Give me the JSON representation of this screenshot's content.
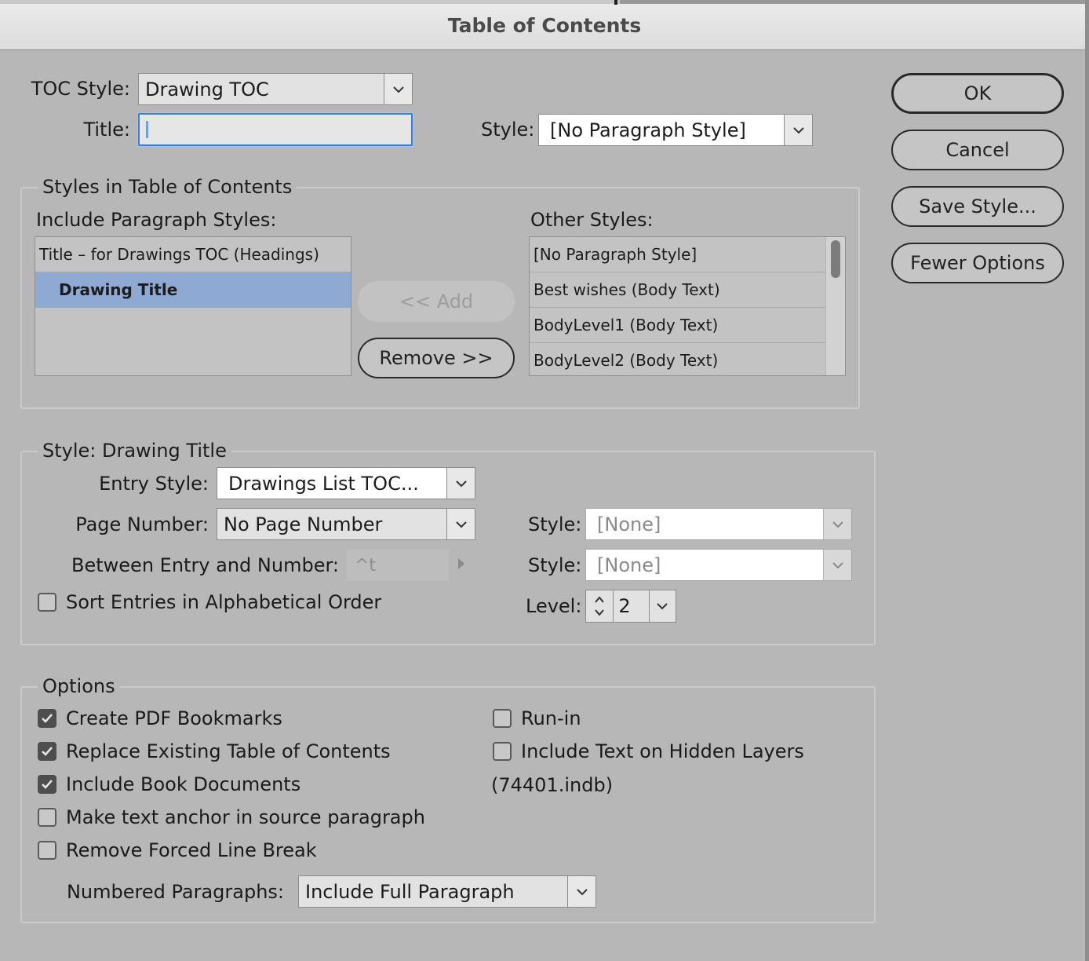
{
  "window": {
    "title": "Table of Contents"
  },
  "toc": {
    "toc_style_label": "TOC Style:",
    "toc_style_value": "Drawing TOC",
    "title_label": "Title:",
    "title_value": "",
    "style_label": "Style:",
    "style_value": "[No Paragraph Style]"
  },
  "buttons": {
    "ok": "OK",
    "cancel": "Cancel",
    "save_style": "Save Style...",
    "fewer_options": "Fewer Options",
    "add": "<< Add",
    "remove": "Remove >>"
  },
  "styles_group": {
    "legend": "Styles in Table of Contents",
    "include_label": "Include Paragraph Styles:",
    "include_items": [
      "Title – for Drawings TOC (Headings)",
      "Drawing Title"
    ],
    "selected_item": "Drawing Title",
    "other_label": "Other Styles:",
    "other_items": [
      "[No Paragraph Style]",
      "Best wishes (Body Text)",
      "BodyLevel1 (Body Text)",
      "BodyLevel2 (Body Text)"
    ]
  },
  "style_group": {
    "legend": "Style: Drawing Title",
    "entry_style_label": "Entry Style:",
    "entry_style_value": "Drawings List TOC...",
    "page_number_label": "Page Number:",
    "page_number_value": "No Page Number",
    "page_style_label": "Style:",
    "page_style_value": "[None]",
    "between_label": "Between Entry and Number:",
    "between_value": "^t",
    "between_style_label": "Style:",
    "between_style_value": "[None]",
    "sort_label": "Sort Entries in Alphabetical Order",
    "sort_checked": false,
    "level_label": "Level:",
    "level_value": "2"
  },
  "options_group": {
    "legend": "Options",
    "create_pdf_bookmarks": {
      "label": "Create PDF Bookmarks",
      "checked": true
    },
    "replace_existing": {
      "label": "Replace Existing Table of Contents",
      "checked": true
    },
    "include_book": {
      "label": "Include Book Documents",
      "checked": true
    },
    "make_anchor": {
      "label": "Make text anchor in source paragraph",
      "checked": false
    },
    "remove_forced": {
      "label": "Remove Forced Line Break",
      "checked": false
    },
    "run_in": {
      "label": "Run-in",
      "checked": false
    },
    "include_hidden": {
      "label": "Include Text on Hidden Layers",
      "checked": false
    },
    "book_file": "(74401.indb)",
    "numbered_label": "Numbered Paragraphs:",
    "numbered_value": "Include Full Paragraph"
  },
  "colors": {
    "selection": "#8eaad3",
    "focus_ring": "#3d7bd9",
    "dialog_bg": "#b7b7b7"
  }
}
